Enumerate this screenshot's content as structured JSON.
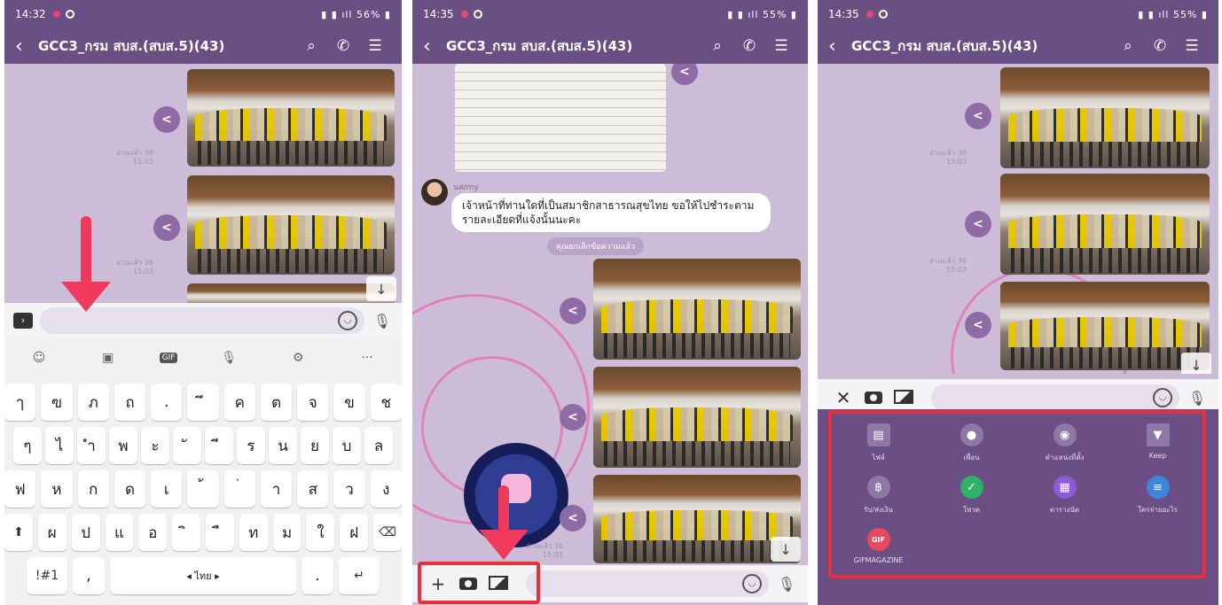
{
  "phones": [
    {
      "status": {
        "time": "14:32",
        "right": "56%"
      },
      "header": {
        "title": "GCC3_กรม สบส.(สบส.5)(43)"
      },
      "read_labels": [
        "อ่านแล้ว 36\n15:03",
        "อ่านแล้ว 36\n15:03"
      ],
      "keyboard": {
        "rows": [
          [
            "ๅ",
            "ฃ",
            "ภ",
            "ถ",
            ".",
            "ึ",
            "ค",
            "ต",
            "จ",
            "ข",
            "ช"
          ],
          [
            "ๆ",
            "ไ",
            "ำ",
            "พ",
            "ะ",
            "ั",
            "ี",
            "ร",
            "น",
            "ย",
            "บ",
            "ล"
          ],
          [
            "ฟ",
            "ห",
            "ก",
            "ด",
            "เ",
            "้",
            "่",
            "า",
            "ส",
            "ว",
            "ง"
          ],
          [
            "ผ",
            "ป",
            "แ",
            "อ",
            "ิ",
            "ื",
            "ท",
            "ม",
            "ใ",
            "ฝ"
          ]
        ],
        "sym_key": "!#1",
        "comma_key": ",",
        "space_label": "◂ ไทย ▸",
        "period_key": "."
      }
    },
    {
      "status": {
        "time": "14:35",
        "right": "55%"
      },
      "header": {
        "title": "GCC3_กรม สบส.(สบส.5)(43)"
      },
      "sender": "นส/my",
      "message": "เจ้าหน้าที่ท่านใดที่เป็นสมาชิกสาธารณสุขไทย ขอให้ไปชำระตามรายละเอียดที่แจ้งนั้นนะคะ",
      "notice": "คุณยกเลิกข้อความแล้ว",
      "read_label": "อ่านแล้ว 36\n15:03"
    },
    {
      "status": {
        "time": "14:35",
        "right": "55%"
      },
      "header": {
        "title": "GCC3_กรม สบส.(สบส.5)(43)"
      },
      "read_labels": [
        "อ่านแล้ว 36\n15:03",
        "อ่านแล้ว 36\n15:03"
      ],
      "menu": [
        {
          "label": "ไฟล์",
          "icon": "file-icon",
          "color": "#8e78a6"
        },
        {
          "label": "เพื่อน",
          "icon": "person-icon",
          "color": "#8e78a6"
        },
        {
          "label": "ตำแหน่งที่ตั้ง",
          "icon": "location-icon",
          "color": "#8e78a6"
        },
        {
          "label": "Keep",
          "icon": "bookmark-icon",
          "color": "#8e78a6"
        },
        {
          "label": "รับ/ส่งเงิน",
          "icon": "baht-icon",
          "color": "#8e78a6"
        },
        {
          "label": "โหวต",
          "icon": "vote-icon",
          "color": "#2fb36b"
        },
        {
          "label": "ตารางนัด",
          "icon": "calendar-icon",
          "color": "#8c5bd6"
        },
        {
          "label": "ใครจ่ายอะไร",
          "icon": "list-icon",
          "color": "#3d86e0"
        },
        {
          "label": "GIFMAGAZINE",
          "icon": "gif-icon",
          "color": "#e8475c"
        }
      ]
    }
  ]
}
